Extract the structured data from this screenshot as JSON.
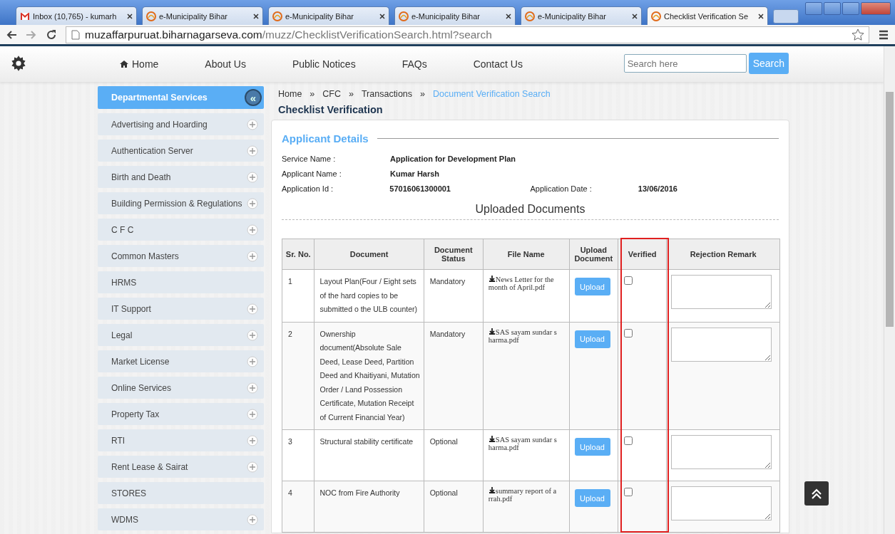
{
  "browser": {
    "tabs": [
      {
        "title": "Inbox (10,765) - kumarh",
        "selected": false
      },
      {
        "title": "e-Municipality Bihar",
        "selected": false
      },
      {
        "title": "e-Municipality Bihar",
        "selected": false
      },
      {
        "title": "e-Municipality Bihar",
        "selected": false
      },
      {
        "title": "e-Municipality Bihar",
        "selected": false
      },
      {
        "title": "Checklist Verification Se",
        "selected": true
      }
    ],
    "url_host": "muzaffarpuruat.biharnagarseva.com",
    "url_path": "/muzz/ChecklistVerificationSearch.html?search"
  },
  "nav": {
    "items": [
      "Home",
      "About Us",
      "Public Notices",
      "FAQs",
      "Contact Us"
    ],
    "search": {
      "placeholder": "Search here",
      "button": "Search"
    }
  },
  "sidebar": {
    "title": "Departmental Services",
    "collapse": "«",
    "items": [
      {
        "label": "Advertising and Hoarding",
        "expandable": true
      },
      {
        "label": "Authentication Server",
        "expandable": true
      },
      {
        "label": "Birth and Death",
        "expandable": true
      },
      {
        "label": "Building Permission & Regulations",
        "expandable": true
      },
      {
        "label": "C F C",
        "expandable": true
      },
      {
        "label": "Common Masters",
        "expandable": true
      },
      {
        "label": "HRMS",
        "expandable": false
      },
      {
        "label": "IT Support",
        "expandable": true
      },
      {
        "label": "Legal",
        "expandable": true
      },
      {
        "label": "Market License",
        "expandable": true
      },
      {
        "label": "Online Services",
        "expandable": true
      },
      {
        "label": "Property Tax",
        "expandable": true
      },
      {
        "label": "RTI",
        "expandable": true
      },
      {
        "label": "Rent Lease & Sairat",
        "expandable": true
      },
      {
        "label": "STORES",
        "expandable": false
      },
      {
        "label": "WDMS",
        "expandable": true
      }
    ]
  },
  "breadcrumb": [
    {
      "label": "Home",
      "current": false
    },
    {
      "separator": "»",
      "label": "CFC",
      "current": false
    },
    {
      "separator": "»",
      "label": "Transactions",
      "current": false
    },
    {
      "separator": "»",
      "label": "Document Verification Search",
      "current": true
    }
  ],
  "page_title": "Checklist Verification",
  "applicant": {
    "heading": "Applicant Details",
    "rows": [
      {
        "fields": [
          {
            "label": "Service Name :",
            "value": "Application for Development Plan"
          }
        ]
      },
      {
        "fields": [
          {
            "label": "Applicant Name :",
            "value": "Kumar Harsh"
          }
        ]
      },
      {
        "fields": [
          {
            "label": "Application Id :",
            "value": "57016061300001"
          },
          {
            "label": "Application Date :",
            "value": "13/06/2016"
          }
        ]
      }
    ]
  },
  "documents": {
    "heading": "Uploaded Documents",
    "columns": [
      "Sr. No.",
      "Document",
      "Document Status",
      "File Name",
      "Upload Document",
      "Verified",
      "Rejection Remark"
    ],
    "rows": [
      {
        "sr": "1",
        "document": "Layout Plan(Four / Eight sets of the hard copies to be submitted o the ULB counter)",
        "status": "Mandatory",
        "file": "News Letter for the month of April.pdf",
        "upload": "Upload",
        "verified": false
      },
      {
        "sr": "2",
        "document": "Ownership document(Absolute Sale Deed, Lease Deed, Partition Deed and Khaitiyani, Mutation Order / Land Possession Certificate, Mutation Receipt of Current Financial Year)",
        "status": "Mandatory",
        "file": "SAS sayam sundar s harma.pdf",
        "upload": "Upload",
        "verified": false
      },
      {
        "sr": "3",
        "document": "Structural stability certificate",
        "status": "Optional",
        "file": "SAS sayam sundar s harma.pdf",
        "upload": "Upload",
        "verified": false
      },
      {
        "sr": "4",
        "document": "NOC from Fire Authority",
        "status": "Optional",
        "file": "summary report of a rrah.pdf",
        "upload": "Upload",
        "verified": false
      }
    ]
  }
}
